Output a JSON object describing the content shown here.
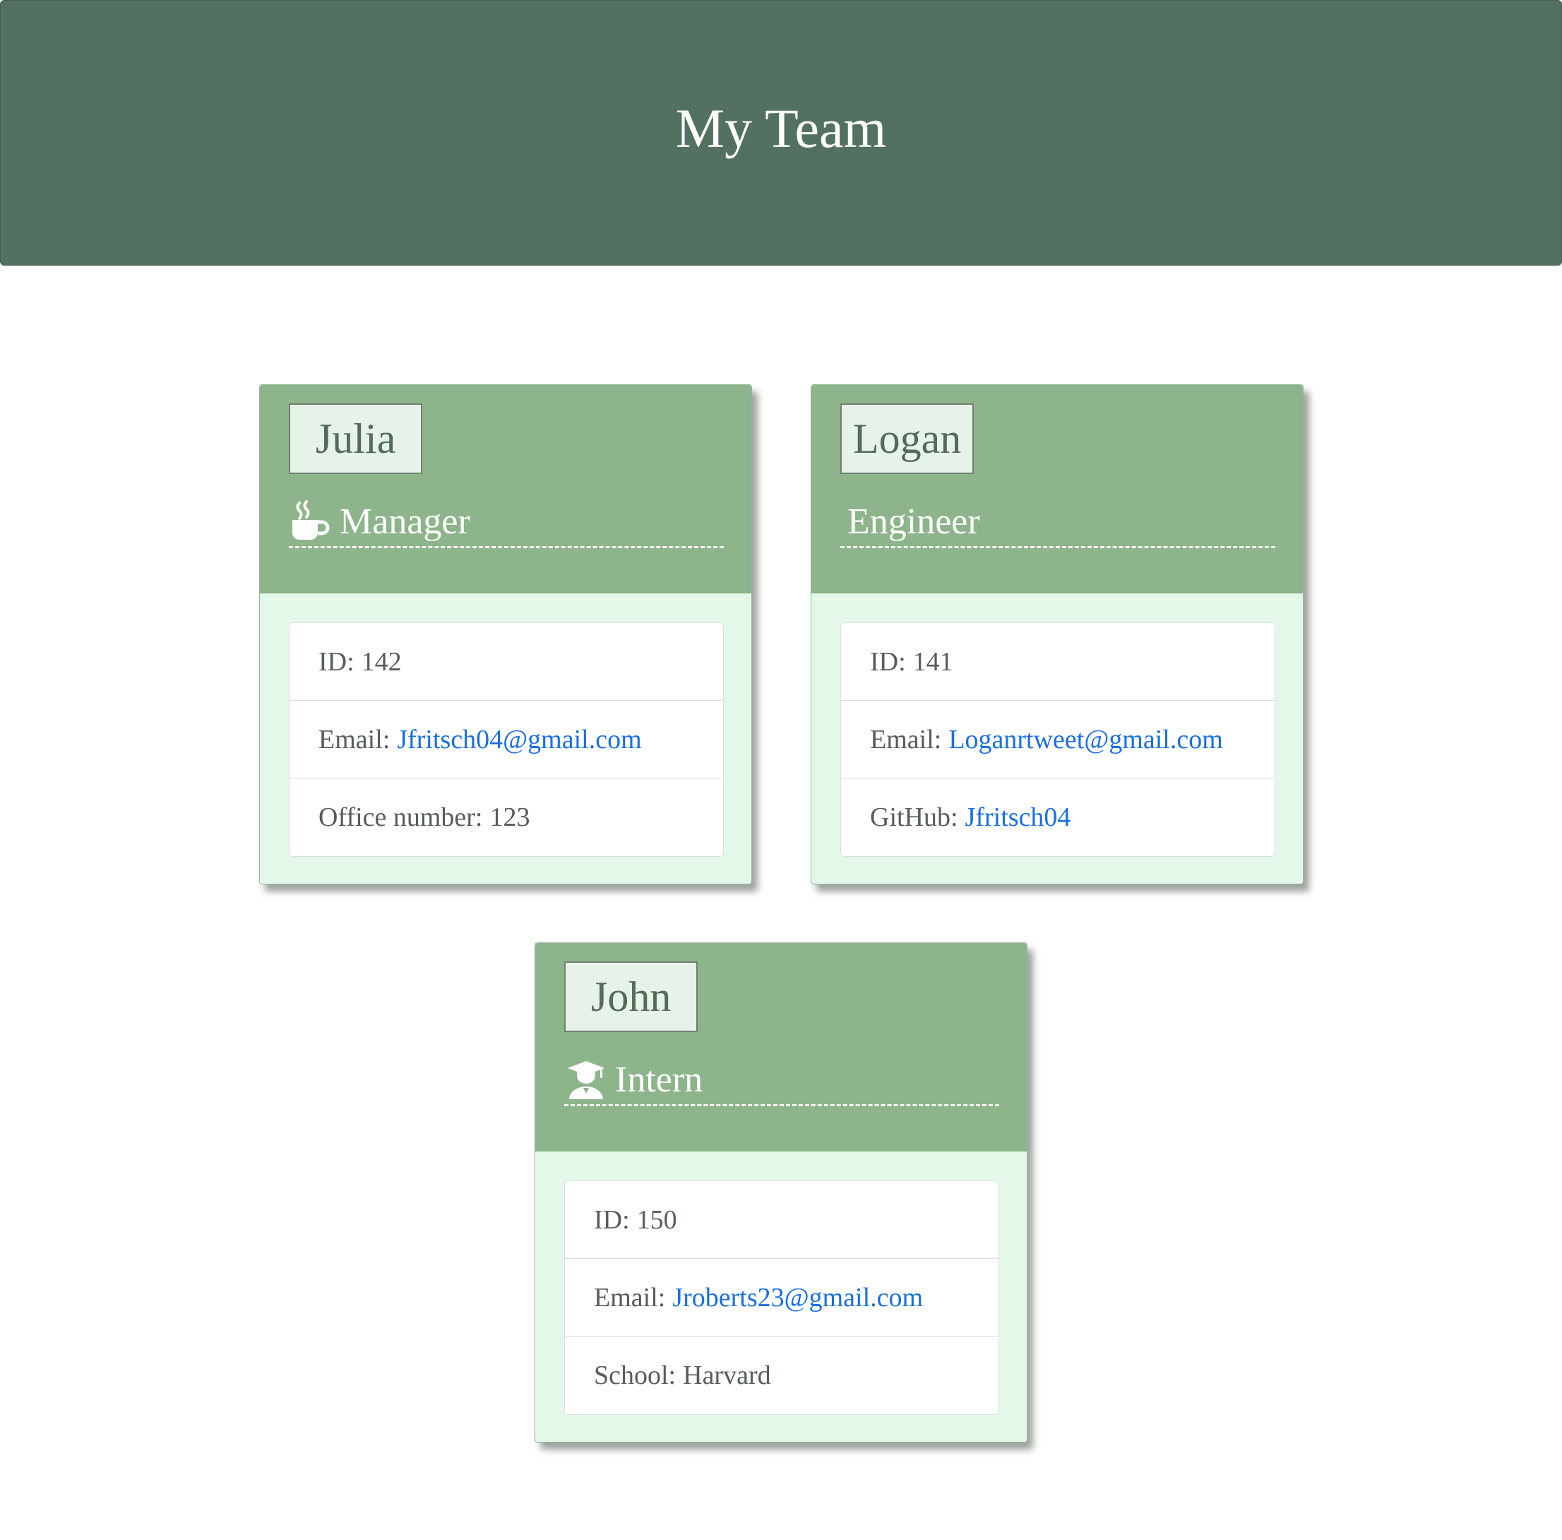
{
  "header": {
    "title": "My Team"
  },
  "team": [
    {
      "name": "Julia",
      "role": "Manager",
      "role_icon": "coffee-mug-icon",
      "id_label": "ID:",
      "id": "142",
      "email_label": "Email:",
      "email": "Jfritsch04@gmail.com",
      "extra_label": "Office number:",
      "extra_value": "123"
    },
    {
      "name": "Logan",
      "role": "Engineer",
      "role_icon": "",
      "id_label": "ID:",
      "id": "141",
      "email_label": "Email:",
      "email": "Loganrtweet@gmail.com",
      "extra_label": "GitHub:",
      "extra_value": "Jfritsch04"
    },
    {
      "name": "John",
      "role": "Intern",
      "role_icon": "graduate-icon",
      "id_label": "ID:",
      "id": "150",
      "email_label": "Email:",
      "email": "Jroberts23@gmail.com",
      "extra_label": "School:",
      "extra_value": "Harvard"
    }
  ],
  "colors": {
    "banner": "#537160",
    "card_header": "#8db48b",
    "card_body": "#e4f8ea",
    "link": "#1a6fe0"
  }
}
